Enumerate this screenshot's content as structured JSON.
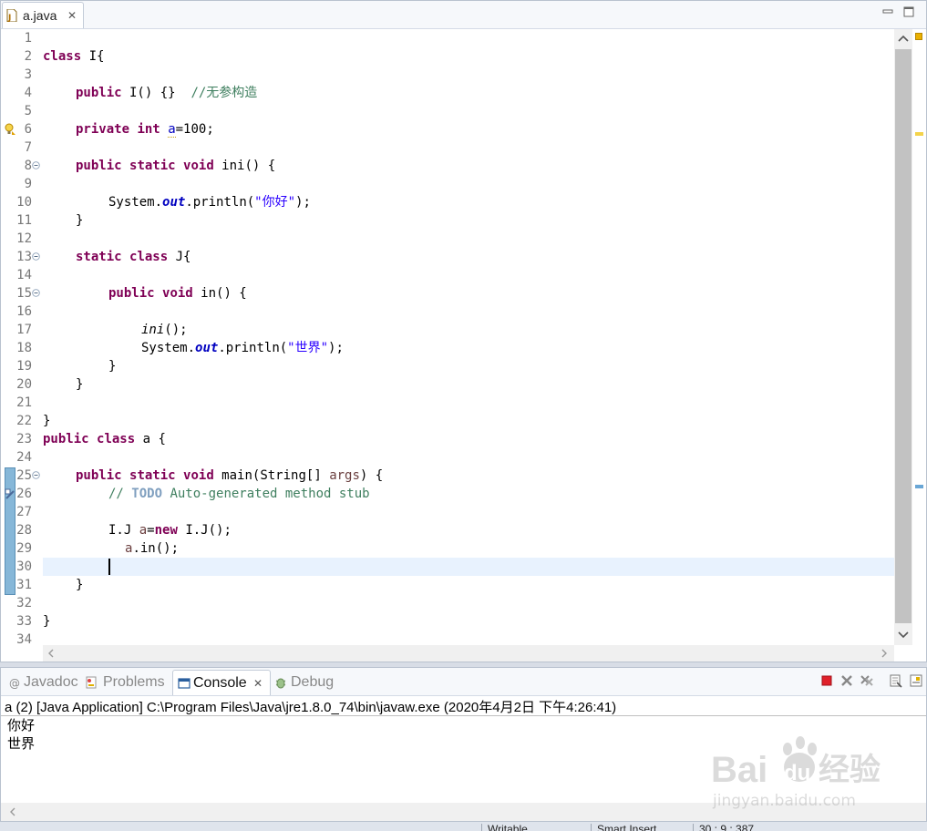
{
  "editor": {
    "tab": {
      "label": "a.java",
      "close_glyph": "✕"
    },
    "line_numbers": [
      "1",
      "2",
      "3",
      "4",
      "5",
      "6",
      "7",
      "8",
      "9",
      "10",
      "11",
      "12",
      "13",
      "14",
      "15",
      "16",
      "17",
      "18",
      "19",
      "20",
      "21",
      "22",
      "23",
      "24",
      "25",
      "26",
      "27",
      "28",
      "29",
      "30",
      "31",
      "32",
      "33",
      "34"
    ],
    "code": {
      "l2": {
        "kw": "class",
        "rest": " I{"
      },
      "l4": {
        "kw": "public",
        "mid": " I() {}  ",
        "comment": "//无参构造"
      },
      "l6": {
        "kw1": "private",
        "kw2": "int",
        "var": "a",
        "rest": "=100;"
      },
      "l8": {
        "kw1": "public",
        "kw2": "static",
        "kw3": "void",
        "rest": " ini() {"
      },
      "l10": {
        "pre": "System.",
        "field": "out",
        "mid": ".println(",
        "str": "\"你好\"",
        "rest": ");"
      },
      "l11": "}",
      "l13": {
        "kw1": "static",
        "kw2": "class",
        "rest": " J{"
      },
      "l15": {
        "kw1": "public",
        "kw2": "void",
        "rest": " in() {"
      },
      "l17": {
        "call": "ini",
        "rest": "();"
      },
      "l18": {
        "pre": "System.",
        "field": "out",
        "mid": ".println(",
        "str": "\"世界\"",
        "rest": ");"
      },
      "l19": "}",
      "l20": "}",
      "l22": "}",
      "l23": {
        "kw1": "public",
        "kw2": "class",
        "rest": " a {"
      },
      "l25": {
        "kw1": "public",
        "kw2": "static",
        "kw3": "void",
        "rest": " main(String[] ",
        "param": "args",
        "end": ") {"
      },
      "l26": {
        "pre": "// ",
        "todo": "TODO",
        "rest": " Auto-generated method stub"
      },
      "l28": {
        "pre": "I.J ",
        "var": "a",
        "mid": "=",
        "kw": "new",
        "rest": " I.J();"
      },
      "l29": {
        "var": "a",
        "rest": ".in();"
      },
      "l31": "}",
      "l33": "}"
    }
  },
  "console": {
    "tabs": [
      {
        "label": "Javadoc",
        "icon": "at-sign-icon",
        "active": false
      },
      {
        "label": "Problems",
        "icon": "problems-icon",
        "active": false
      },
      {
        "label": "Console",
        "icon": "console-icon",
        "active": true,
        "close_glyph": "✕"
      },
      {
        "label": "Debug",
        "icon": "bug-icon",
        "active": false
      }
    ],
    "description": "a (2) [Java Application] C:\\Program Files\\Java\\jre1.8.0_74\\bin\\javaw.exe (2020年4月2日 下午4:26:41)",
    "output": [
      "你好",
      "世界"
    ]
  },
  "status_bar": {
    "fields": [
      "Writable",
      "Smart Insert",
      "30 : 9 : 387"
    ]
  },
  "watermark": {
    "brand_text": "Bai",
    "brand_text2": "du",
    "brand_cn": "经验",
    "url": "jingyan.baidu.com"
  },
  "colors": {
    "keyword": "#7f0055",
    "string": "#2a00ff",
    "comment": "#3f7f5f",
    "field": "#0000c0",
    "current_line": "#e8f2fe",
    "terminate_button": "#e0202a"
  }
}
